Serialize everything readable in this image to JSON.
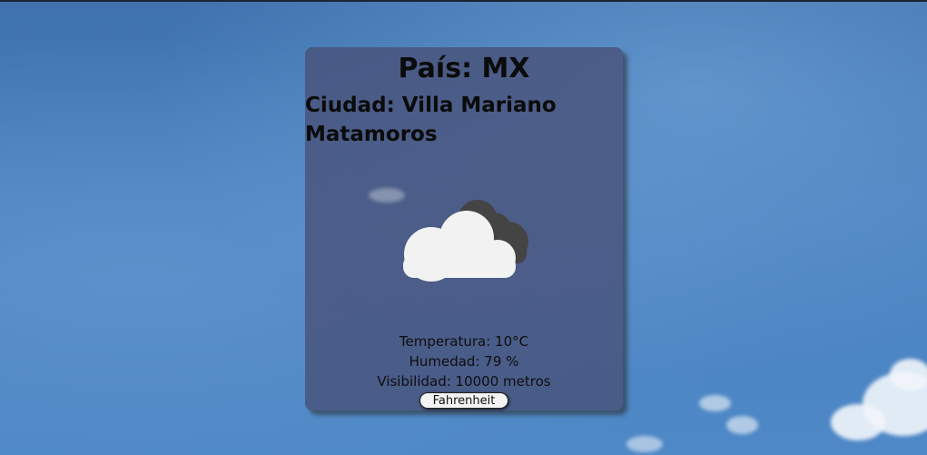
{
  "weather": {
    "pais": "País: MX",
    "ciudad": "Ciudad: Villa Mariano Matamoros",
    "icon": "partly-cloudy-icon",
    "temperatura": "Temperatura: 10°C",
    "humedad": "Humedad: 79 %",
    "visibilidad": "Visibilidad: 10000 metros",
    "unit_button_label": "Fahrenheit"
  },
  "colors": {
    "card_background": "#485076",
    "sky": "#4a82c0",
    "cloud_front": "#f2f2f2",
    "cloud_back": "#444444"
  }
}
